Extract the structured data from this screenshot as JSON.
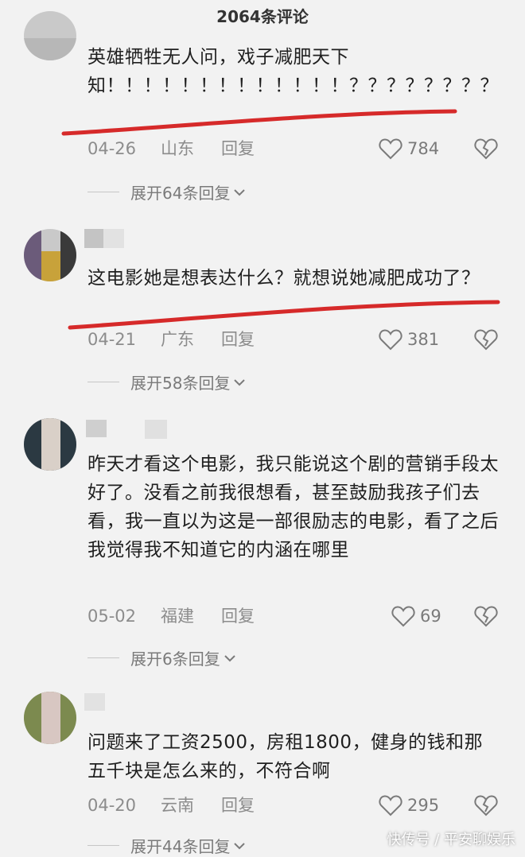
{
  "header": {
    "title": "2064条评论"
  },
  "comments": [
    {
      "text": "英雄牺牲无人问，戏子减肥天下知！！！！！！！！！！！！！？？？？？？？？",
      "date": "04-26",
      "location": "山东",
      "reply_label": "回复",
      "likes": "784",
      "expand_label": "展开64条回复"
    },
    {
      "text": "这电影她是想表达什么？就想说她减肥成功了？",
      "date": "04-21",
      "location": "广东",
      "reply_label": "回复",
      "likes": "381",
      "expand_label": "展开58条回复"
    },
    {
      "text": "昨天才看这个电影，我只能说这个剧的营销手段太好了。没看之前我很想看，甚至鼓励我孩子们去看，我一直以为这是一部很励志的电影，看了之后我觉得我不知道它的内涵在哪里",
      "date": "05-02",
      "location": "福建",
      "reply_label": "回复",
      "likes": "69",
      "expand_label": "展开6条回复"
    },
    {
      "text": "问题来了工资2500，房租1800，健身的钱和那五千块是怎么来的，不符合啊",
      "date": "04-20",
      "location": "云南",
      "reply_label": "回复",
      "likes": "295",
      "expand_label": "展开44条回复"
    }
  ],
  "watermark": "快传号 / 平安聊娱乐",
  "colors": {
    "annotation_red": "#d62a2a",
    "meta_gray": "#8c8c8c",
    "background": "#f2f2f2"
  }
}
